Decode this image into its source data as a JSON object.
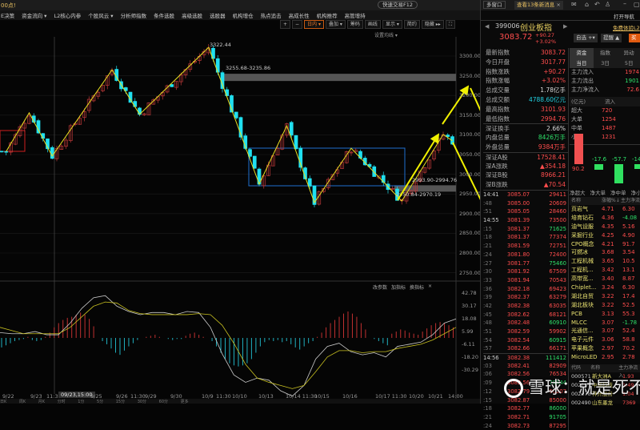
{
  "topbar": {
    "title": "00点!",
    "quick_trade": "快速交易F12"
  },
  "menu": [
    "E决策",
    "资金流向 ▾",
    "L2核心内参",
    "个股风云 ▾",
    "分析师指数",
    "条件选股",
    "高级选股",
    "选股器",
    "机构增仓",
    "热点追击",
    "高成长性",
    "机构推荐",
    "高管增持"
  ],
  "toolbar": {
    "plus": "+",
    "minus": "−",
    "period": "日内 ▾",
    "overlay": "叠加 ▾",
    "chips": "筹码",
    "draw": "画线",
    "display": "显示 ▾",
    "simple": "简约",
    "hide": "隐藏 ▸▸",
    "fullscreen": "⛶",
    "set_ma": "设置均线 ▾"
  },
  "chart_annotations": {
    "high": "3322.44",
    "gap_top": "3255.68-3235.86",
    "gap_mid": "2993.90-2994.76",
    "gap_low": "2950.84-2970.19"
  },
  "chart_data": {
    "type": "candlestick",
    "y_ticks": [
      "3300.00",
      "3250.00",
      "3200.00",
      "3150.00",
      "3100.00",
      "3050.00",
      "3000.00",
      "2950.00",
      "2900.00",
      "2850.00",
      "2800.00",
      "2750.00"
    ],
    "ylim": [
      2750,
      3300
    ],
    "zigzag": [
      [
        1,
        3058
      ],
      [
        6,
        3156
      ],
      [
        11,
        3046
      ],
      [
        24,
        3265
      ],
      [
        30,
        3152
      ],
      [
        45,
        3322
      ],
      [
        56,
        2975
      ],
      [
        62,
        3123
      ],
      [
        68,
        2928
      ],
      [
        76,
        3066
      ],
      [
        87,
        2932
      ],
      [
        96,
        3101
      ],
      [
        98,
        3085
      ]
    ],
    "x_labels": [
      "9/22",
      "9/23",
      "11:30",
      "09/23,15:00",
      "9/25",
      "9/26",
      "11:30",
      "9/29",
      "9/30",
      "10/9",
      "11:30",
      "10/10",
      "10/13",
      "10/14 11:30",
      "10/15",
      "10/16",
      "10/17 11:30",
      "10/20",
      "10/21",
      "14:00"
    ],
    "macd": {
      "buttons": [
        "改参数",
        "加指标",
        "换指标",
        "×"
      ],
      "y_ticks": [
        "42.78",
        "30.17",
        "18.08",
        "5.99",
        "-6.11",
        "-18.20",
        "-30.29"
      ],
      "hist": [
        -9,
        -7,
        -5,
        -3,
        -2,
        -1,
        1,
        -2,
        -3,
        -2,
        1,
        5,
        10,
        14,
        17,
        19,
        20,
        22,
        24,
        22,
        18,
        11,
        0,
        -3,
        -6,
        -10,
        -14,
        -16,
        -12,
        -8,
        -5,
        -2,
        0,
        1,
        2,
        3,
        1,
        0,
        -1,
        -2,
        -1,
        -1,
        2,
        4,
        5,
        3,
        1,
        0,
        -3,
        -8,
        -14,
        -20,
        -24,
        -26,
        -27,
        -26,
        -24,
        -20,
        -14,
        -8,
        -4,
        -2,
        -3,
        -2,
        -4,
        -3,
        -6,
        -9,
        -11,
        -8,
        -5,
        -3,
        1,
        5,
        10,
        14,
        17,
        20,
        23,
        25,
        23,
        20,
        14,
        8,
        0,
        -1,
        -3,
        -5,
        -7,
        4,
        6,
        8,
        7,
        5,
        4,
        3,
        6,
        9,
        12,
        14,
        15,
        14,
        12,
        10
      ],
      "dif": [
        5,
        4,
        4,
        6,
        3,
        3,
        14,
        28,
        38,
        40,
        30,
        25,
        22,
        24,
        24,
        22,
        25,
        24,
        10,
        -15,
        -35,
        -42,
        -38,
        -40,
        -50,
        -55,
        -45,
        -20,
        -8,
        -5,
        -13,
        -16,
        -14,
        -18,
        -8,
        -6,
        -4,
        3,
        14,
        18
      ],
      "dea": [
        10,
        7,
        4,
        4,
        4,
        4,
        10,
        20,
        30,
        34,
        33,
        26,
        23,
        22,
        22,
        22,
        22,
        23,
        22,
        12,
        -5,
        -25,
        -38,
        -42,
        -45,
        -48,
        -45,
        -32,
        -18,
        -12,
        -12,
        -14,
        -13,
        -13,
        -10,
        -8,
        -6,
        -2,
        4,
        10
      ]
    }
  },
  "bottom_tabs": "日K 周K 月K 分时 1分 5分 15分 30分 60分 更多",
  "right": {
    "tabs": [
      "多窗口",
      "查看13条新消息"
    ],
    "nav": "打开导航",
    "code": "399006",
    "name": "创业板指",
    "free_l2": "免费体验L2",
    "price": "3083.72",
    "change": "+90.27",
    "pct": "+3.02%",
    "btn_fav": "自选 +▾",
    "btn_alert": "提醒 ▲",
    "btn_buy": "买指",
    "stats": [
      [
        "最新指数",
        "3083.72",
        "red"
      ],
      [
        "今日开盘",
        "3017.77",
        "red"
      ],
      [
        "指数涨跌",
        "+90.27",
        "red"
      ],
      [
        "指数涨幅",
        "+3.02%",
        "red"
      ],
      [
        "总成交量",
        "1.78亿手",
        "wh"
      ],
      [
        "总成交额",
        "4788.60亿元",
        "cy"
      ],
      [
        "最高指数",
        "3101.93",
        "red"
      ],
      [
        "最低指数",
        "2994.76",
        "red"
      ],
      [
        "深证换手",
        "2.66%",
        "wh"
      ],
      [
        "内盘总量",
        "8426万手",
        "grn"
      ],
      [
        "外盘总量",
        "9384万手",
        "red"
      ],
      [
        "深证A股",
        "17528.41",
        "red"
      ],
      [
        "深A涨跌",
        "▲354.18",
        "red"
      ],
      [
        "深证B股",
        "8966.21",
        "red"
      ],
      [
        "深B涨跌",
        "▲70.54",
        "red"
      ]
    ],
    "flow_tabs": [
      "资金",
      "指数",
      "异动"
    ],
    "flow_days": [
      "当日",
      "3日",
      "5日"
    ],
    "flows": [
      [
        "主力流入",
        "1974",
        "red"
      ],
      [
        "主力流出",
        "1901",
        "grn"
      ],
      [
        "主力净流入",
        "72.6",
        "red"
      ]
    ],
    "flow_head": [
      "(亿元)",
      "流入"
    ],
    "flow_rows": [
      [
        "超大",
        "720"
      ],
      [
        "大单",
        "1254"
      ],
      [
        "中单",
        "1487"
      ],
      [
        "小单",
        "1231"
      ]
    ],
    "bars": [
      [
        "90.2",
        90.2
      ],
      [
        "-17.6",
        -17.6
      ],
      [
        "-57.7",
        -57.7
      ],
      [
        "-14",
        -14
      ]
    ],
    "bar_labels": [
      "净超大",
      "净大单",
      "净中单",
      "净小"
    ],
    "ticks": [
      [
        "14:41",
        "3085.07",
        "29411",
        "red"
      ],
      [
        ":48",
        "3085.00",
        "20609",
        "red"
      ],
      [
        ":51",
        "3085.05",
        "28460",
        "red"
      ],
      [
        "14:55",
        "3081.39",
        "73500",
        "red"
      ],
      [
        ":15",
        "3081.37",
        "71625",
        "grn"
      ],
      [
        ":18",
        "3081.37",
        "77374",
        "red"
      ],
      [
        ":21",
        "3081.59",
        "72751",
        "red"
      ],
      [
        ":24",
        "3081.80",
        "72400",
        "red"
      ],
      [
        ":27",
        "3081.77",
        "75460",
        "grn"
      ],
      [
        ":30",
        "3081.92",
        "67509",
        "red"
      ],
      [
        ":33",
        "3081.94",
        "70543",
        "red"
      ],
      [
        ":36",
        "3082.18",
        "69423",
        "red"
      ],
      [
        ":39",
        "3082.37",
        "63279",
        "red"
      ],
      [
        ":42",
        "3082.38",
        "63035",
        "red"
      ],
      [
        ":45",
        "3082.62",
        "68121",
        "red"
      ],
      [
        ":48",
        "3082.48",
        "60910",
        "grn"
      ],
      [
        ":51",
        "3082.59",
        "59902",
        "red"
      ],
      [
        ":54",
        "3082.54",
        "60915",
        "grn"
      ],
      [
        ":57",
        "3082.66",
        "66171",
        "red"
      ],
      [
        "14:56",
        "3082.38",
        "111412",
        "grn"
      ],
      [
        ":03",
        "3082.41",
        "82909",
        "red"
      ],
      [
        ":06",
        "3082.56",
        "76534",
        "red"
      ],
      [
        ":09",
        "3082.56",
        "79644",
        "grn"
      ],
      [
        ":12",
        "3082.79",
        "90207",
        "red"
      ],
      [
        ":15",
        "3082.87",
        "85000",
        "red"
      ],
      [
        ":18",
        "3082.77",
        "86000",
        "grn"
      ],
      [
        ":21",
        "3082.71",
        "91705",
        "grn"
      ],
      [
        ":24",
        "3082.73",
        "87295",
        "red"
      ]
    ],
    "sec_head": [
      "名称",
      "涨幅%↓",
      "主力净流"
    ],
    "sectors": [
      [
        "页岩气",
        "4.71",
        "6.30"
      ],
      [
        "培育钻石",
        "4.36",
        "-4.08"
      ],
      [
        "油气设服",
        "4.35",
        "5.16"
      ],
      [
        "采掘行业",
        "4.25",
        "4.90"
      ],
      [
        "CPO概念",
        "4.21",
        "91.7"
      ],
      [
        "可燃冰",
        "3.68",
        "3.54"
      ],
      [
        "工程机械",
        "3.65",
        "10.5"
      ],
      [
        "工程机...",
        "3.42",
        "13.1"
      ],
      [
        "高带宽...",
        "3.40",
        "8.87"
      ],
      [
        "Chiplet...",
        "3.24",
        "6.30"
      ],
      [
        "湖北自贸",
        "3.22",
        "17.4"
      ],
      [
        "湖北板块",
        "3.22",
        "52.5"
      ],
      [
        "PCB",
        "3.13",
        "55.3"
      ],
      [
        "MLCC",
        "3.07",
        "-1.78"
      ],
      [
        "光通信...",
        "3.07",
        "52.4"
      ],
      [
        "电子元件",
        "3.06",
        "58.8"
      ],
      [
        "苹果概念",
        "2.97",
        "70.2"
      ],
      [
        "MicroLED",
        "2.95",
        "2.78"
      ]
    ],
    "stock_head": [
      "代码",
      "名称",
      "主力净流入"
    ],
    "stocks": [
      [
        "000571",
        "新大洲A",
        "1.93"
      ],
      [
        "002137",
        "中船科技",
        "1.49"
      ],
      [
        "002278",
        "神开股份",
        "1.04"
      ],
      [
        "002490",
        "山东墨龙",
        "7369"
      ]
    ]
  },
  "watermark": "雪球：就是死不了"
}
